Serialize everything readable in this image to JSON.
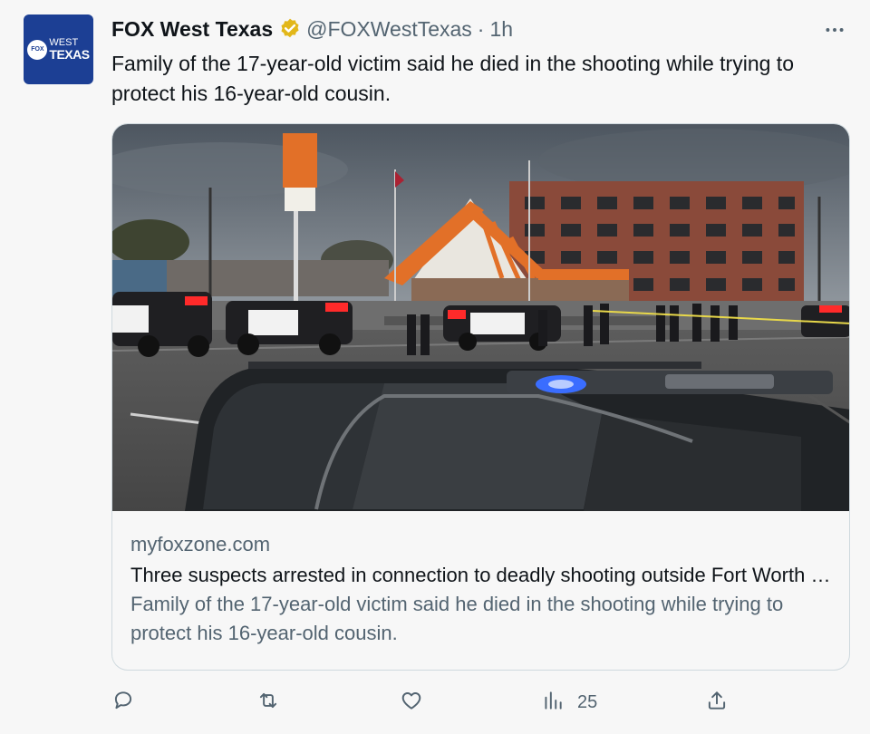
{
  "account": {
    "avatar_text_brand": "FOX",
    "avatar_text_line1": "WEST",
    "avatar_text_line2": "TEXAS",
    "name": "FOX West Texas",
    "handle": "@FOXWestTexas",
    "separator": "·",
    "time": "1h",
    "verified_color": "#e2b719"
  },
  "tweet": {
    "text": "Family of the 17-year-old victim said he died in the shooting while trying to protect his 16-year-old cousin."
  },
  "card": {
    "image_alt": "police vehicles outside a fast-food restaurant at dusk",
    "domain": "myfoxzone.com",
    "title": "Three suspects arrested in connection to deadly shooting outside Fort Worth Whataburger",
    "description": "Family of the 17-year-old victim said he died in the shooting while trying to protect his 16-year-old cousin."
  },
  "actions": {
    "reply_icon": "reply-icon",
    "retweet_icon": "retweet-icon",
    "like_icon": "like-icon",
    "views_icon": "views-icon",
    "views_count": "25",
    "share_icon": "share-icon"
  },
  "colors": {
    "brand_blue": "#1c3f94",
    "text_primary": "#0f1419",
    "text_secondary": "#536471",
    "border": "#cfd9de"
  }
}
